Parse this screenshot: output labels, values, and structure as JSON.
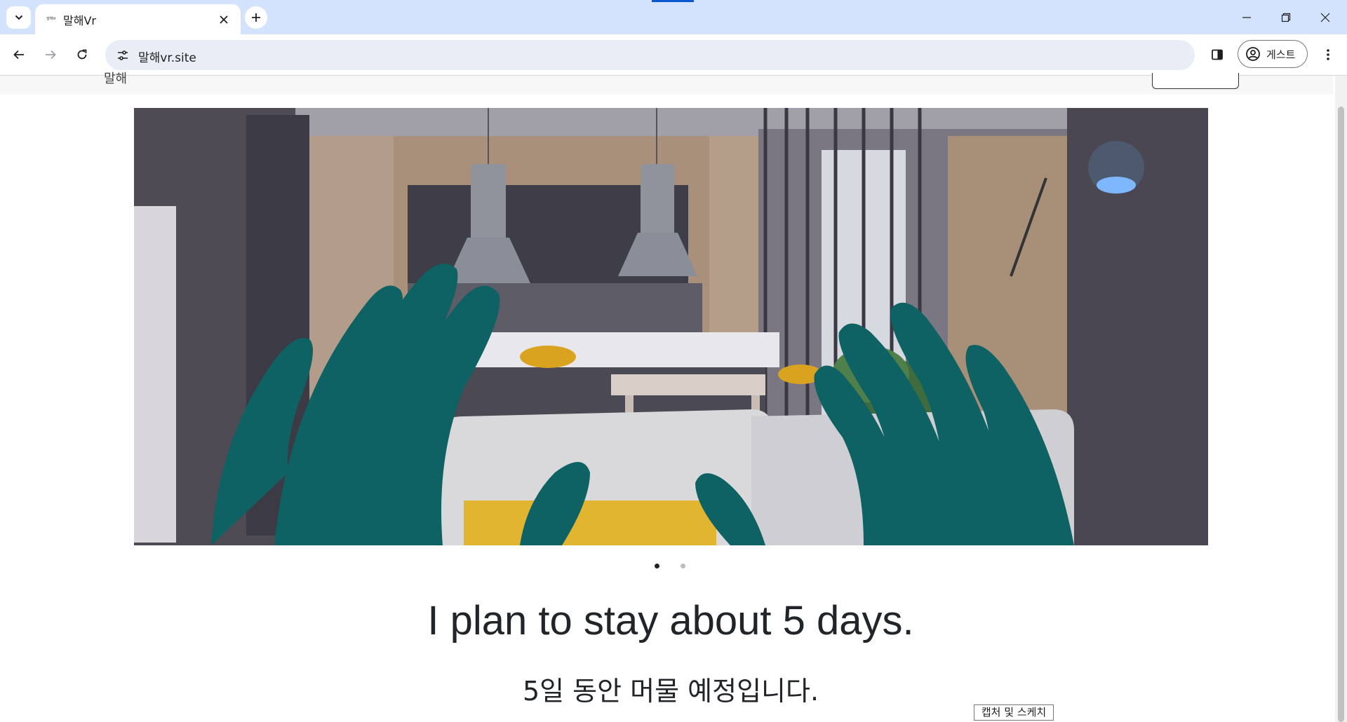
{
  "browser": {
    "tab": {
      "title": "말해Vr",
      "favicon_text": "말해Vr"
    },
    "address_bar": {
      "url": "말해vr.site"
    },
    "profile": {
      "label": "게스트"
    },
    "icons": {
      "tab_search": "chevron-down-icon",
      "close_tab": "close-icon",
      "new_tab": "plus-icon",
      "minimize": "minimize-icon",
      "restore": "restore-icon",
      "close_window": "close-icon",
      "back": "arrow-left-icon",
      "forward": "arrow-right-icon",
      "reload": "reload-icon",
      "site_info": "tune-icon",
      "side_panel": "side-panel-icon",
      "profile": "account-circle-icon",
      "menu": "more-vertical-icon"
    },
    "colors": {
      "tabstrip_bg": "#d3e3fd",
      "omnibox_bg": "#e9eef6",
      "accent": "#0b57d0"
    }
  },
  "page": {
    "header_text": "말해",
    "carousel": {
      "image_description_icon": "vr-kitchen-scene-image",
      "slide_count": 2,
      "active_slide": 1
    },
    "sentence_en": "I plan to stay about 5 days.",
    "sentence_ko": "5일 동안 머물 예정입니다.",
    "colors": {
      "hand": "#0e6263",
      "text": "#212529"
    }
  },
  "overlay": {
    "capture_tooltip": "캡처 및 스케치"
  }
}
